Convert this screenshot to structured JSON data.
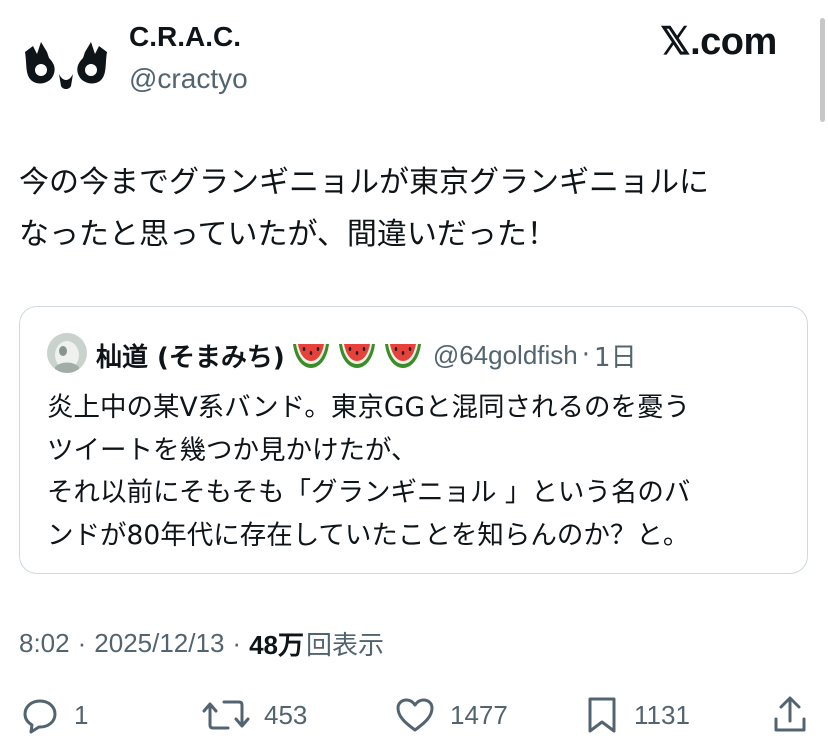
{
  "header": {
    "display_name": "C.R.A.C.",
    "handle": "@cractyo",
    "site_label": "𝕏.com",
    "avatar_icon": "hands-ok-gesture-logo"
  },
  "tweet": {
    "lines": [
      "今の今までグランギニョルが東京グランギニョルに",
      "なったと思っていたが、間違いだった！"
    ]
  },
  "quote": {
    "display_name": "杣道 (そまみち)",
    "emojis": [
      "watermelon",
      "watermelon",
      "watermelon"
    ],
    "handle": "@64goldfish",
    "separator": "·",
    "time": "1日",
    "lines": [
      "炎上中の某V系バンド。東京GGと混同されるのを憂う",
      "ツイートを幾つか見かけたが、",
      "それ以前にそもそも「グランギニョル 」という名のバ",
      "ンドが80年代に存在していたことを知らんのか？と。"
    ]
  },
  "meta": {
    "time": "8:02",
    "sep1": "·",
    "date": "2025/12/13",
    "sep2": "·",
    "views_count": "48万",
    "views_label": "回表示"
  },
  "actions": {
    "reply_count": "1",
    "retweet_count": "453",
    "like_count": "1477",
    "bookmark_count": "1131"
  },
  "colors": {
    "text": "#0f1419",
    "secondary": "#536471",
    "border": "#cfd9de"
  }
}
